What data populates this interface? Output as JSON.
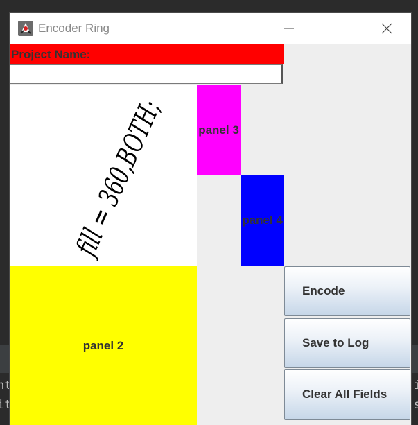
{
  "window": {
    "title": "Encoder Ring",
    "app_icon": "java-duke-icon",
    "controls": [
      "minimize-icon",
      "maximize-icon",
      "close-icon"
    ]
  },
  "form": {
    "project_label": "Project Name:",
    "project_value": "",
    "project_placeholder": ""
  },
  "panels": {
    "panel2": "panel 2",
    "panel3": "panel 3",
    "panel4": "panel 4"
  },
  "drawing": {
    "handwritten_text": "fill = 360,BOTH;"
  },
  "buttons": {
    "encode": "Encode",
    "save": "Save to Log",
    "clear": "Clear All Fields"
  },
  "colors": {
    "project_label_bg": "#ff0000",
    "panel2_bg": "#ffff00",
    "panel3_bg": "#ff00ff",
    "panel4_bg": "#0000ff"
  }
}
